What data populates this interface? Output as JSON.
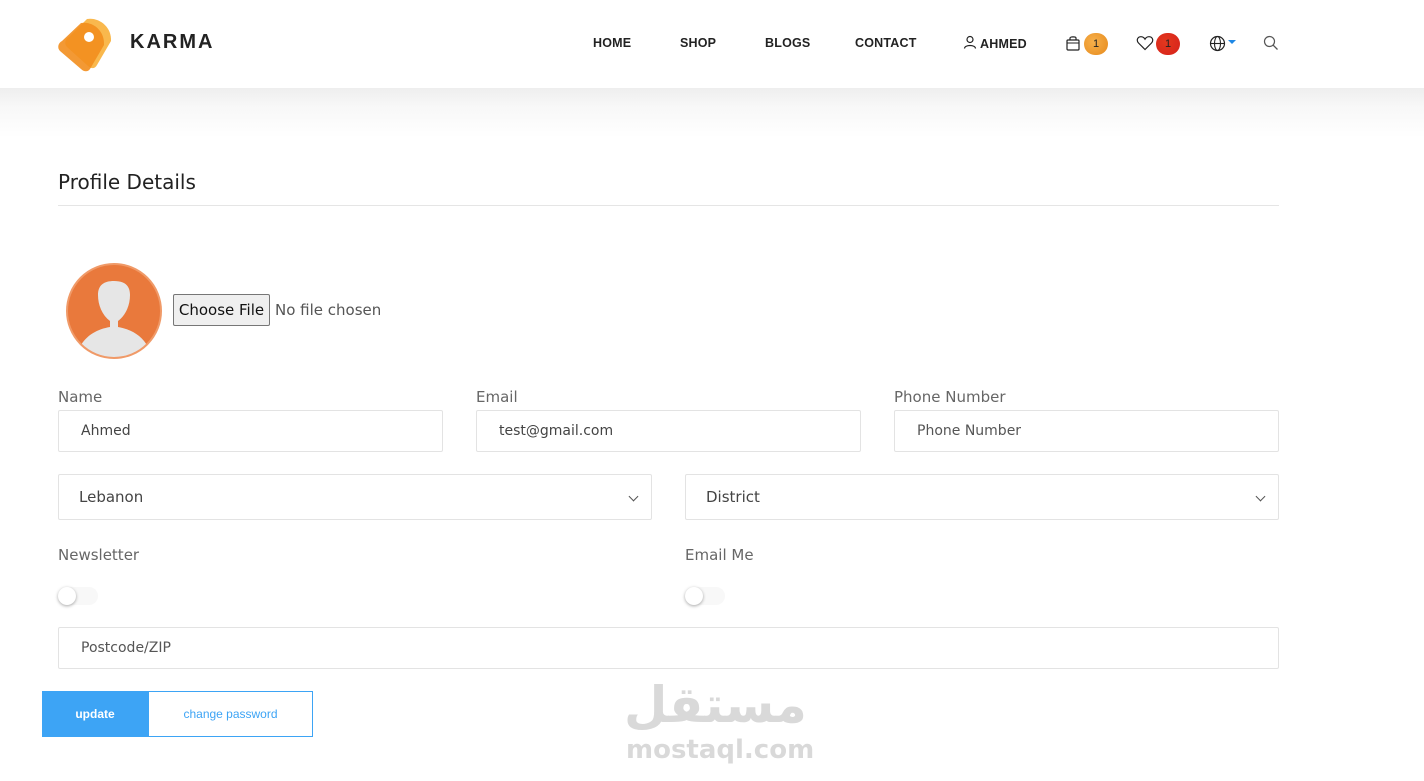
{
  "header": {
    "brand": "KARMA",
    "nav": {
      "home": "HOME",
      "shop": "SHOP",
      "blogs": "BLOGS",
      "contact": "CONTACT",
      "user": "AHMED"
    },
    "cart_count": "1",
    "wishlist_count": "1",
    "icons": [
      "user-icon",
      "cart-icon",
      "heart-icon",
      "globe-icon",
      "search-icon"
    ],
    "colors": {
      "cart_badge": "#e68a1c",
      "wishlist_badge": "#d6211a",
      "accent": "#3da4f5"
    }
  },
  "profile": {
    "title": "Profile Details",
    "file_button": "Choose File",
    "file_status": "No file chosen",
    "name_label": "Name",
    "name_value": "Ahmed",
    "email_label": "Email",
    "email_value": "test@gmail.com",
    "phone_label": "Phone Number",
    "phone_placeholder": "Phone Number",
    "country_value": "Lebanon",
    "district_value": "District",
    "newsletter_label": "Newsletter",
    "newsletter_on": false,
    "emailme_label": "Email Me",
    "emailme_on": false,
    "postcode_placeholder": "Postcode/ZIP",
    "update_button": "update",
    "change_password_button": "change password"
  },
  "watermark": {
    "arabic": "مستقل",
    "latin": "mostaql.com"
  }
}
